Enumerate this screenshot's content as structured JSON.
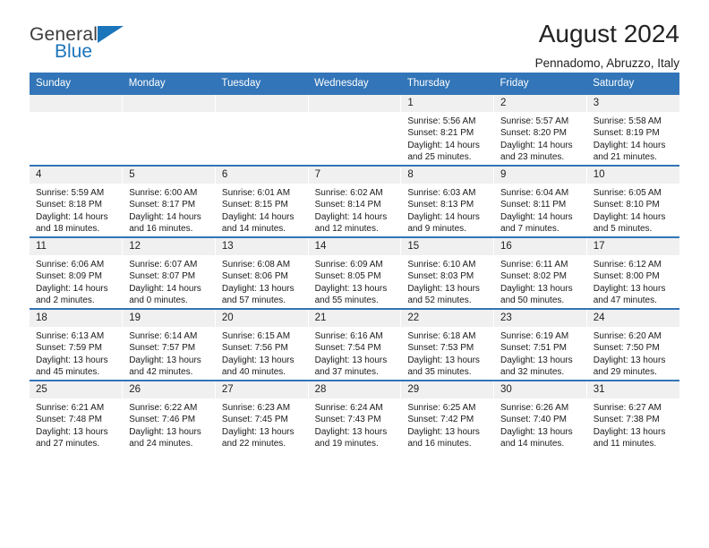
{
  "brand": {
    "name_part1": "General",
    "name_part2": "Blue",
    "triangle_color": "#1b75bb"
  },
  "header": {
    "title": "August 2024",
    "subtitle": "Pennadomo, Abruzzo, Italy"
  },
  "theme": {
    "header_row_bg": "#3275b8",
    "header_row_text": "#ffffff",
    "daynum_bg": "#f0f0f0",
    "cell_bg": "#ffffff",
    "grid_line": "#3275b8"
  },
  "weekday_headers": [
    "Sunday",
    "Monday",
    "Tuesday",
    "Wednesday",
    "Thursday",
    "Friday",
    "Saturday"
  ],
  "labels": {
    "sunrise_prefix": "Sunrise:",
    "sunset_prefix": "Sunset:",
    "daylight_prefix": "Daylight:"
  },
  "weeks": [
    [
      {
        "day": "",
        "blank": true,
        "sunrise": "",
        "sunset": "",
        "daylight_line1": "",
        "daylight_line2": ""
      },
      {
        "day": "",
        "blank": true,
        "sunrise": "",
        "sunset": "",
        "daylight_line1": "",
        "daylight_line2": ""
      },
      {
        "day": "",
        "blank": true,
        "sunrise": "",
        "sunset": "",
        "daylight_line1": "",
        "daylight_line2": ""
      },
      {
        "day": "",
        "blank": true,
        "sunrise": "",
        "sunset": "",
        "daylight_line1": "",
        "daylight_line2": ""
      },
      {
        "day": "1",
        "blank": false,
        "sunrise": "Sunrise: 5:56 AM",
        "sunset": "Sunset: 8:21 PM",
        "daylight_line1": "Daylight: 14 hours",
        "daylight_line2": "and 25 minutes."
      },
      {
        "day": "2",
        "blank": false,
        "sunrise": "Sunrise: 5:57 AM",
        "sunset": "Sunset: 8:20 PM",
        "daylight_line1": "Daylight: 14 hours",
        "daylight_line2": "and 23 minutes."
      },
      {
        "day": "3",
        "blank": false,
        "sunrise": "Sunrise: 5:58 AM",
        "sunset": "Sunset: 8:19 PM",
        "daylight_line1": "Daylight: 14 hours",
        "daylight_line2": "and 21 minutes."
      }
    ],
    [
      {
        "day": "4",
        "blank": false,
        "sunrise": "Sunrise: 5:59 AM",
        "sunset": "Sunset: 8:18 PM",
        "daylight_line1": "Daylight: 14 hours",
        "daylight_line2": "and 18 minutes."
      },
      {
        "day": "5",
        "blank": false,
        "sunrise": "Sunrise: 6:00 AM",
        "sunset": "Sunset: 8:17 PM",
        "daylight_line1": "Daylight: 14 hours",
        "daylight_line2": "and 16 minutes."
      },
      {
        "day": "6",
        "blank": false,
        "sunrise": "Sunrise: 6:01 AM",
        "sunset": "Sunset: 8:15 PM",
        "daylight_line1": "Daylight: 14 hours",
        "daylight_line2": "and 14 minutes."
      },
      {
        "day": "7",
        "blank": false,
        "sunrise": "Sunrise: 6:02 AM",
        "sunset": "Sunset: 8:14 PM",
        "daylight_line1": "Daylight: 14 hours",
        "daylight_line2": "and 12 minutes."
      },
      {
        "day": "8",
        "blank": false,
        "sunrise": "Sunrise: 6:03 AM",
        "sunset": "Sunset: 8:13 PM",
        "daylight_line1": "Daylight: 14 hours",
        "daylight_line2": "and 9 minutes."
      },
      {
        "day": "9",
        "blank": false,
        "sunrise": "Sunrise: 6:04 AM",
        "sunset": "Sunset: 8:11 PM",
        "daylight_line1": "Daylight: 14 hours",
        "daylight_line2": "and 7 minutes."
      },
      {
        "day": "10",
        "blank": false,
        "sunrise": "Sunrise: 6:05 AM",
        "sunset": "Sunset: 8:10 PM",
        "daylight_line1": "Daylight: 14 hours",
        "daylight_line2": "and 5 minutes."
      }
    ],
    [
      {
        "day": "11",
        "blank": false,
        "sunrise": "Sunrise: 6:06 AM",
        "sunset": "Sunset: 8:09 PM",
        "daylight_line1": "Daylight: 14 hours",
        "daylight_line2": "and 2 minutes."
      },
      {
        "day": "12",
        "blank": false,
        "sunrise": "Sunrise: 6:07 AM",
        "sunset": "Sunset: 8:07 PM",
        "daylight_line1": "Daylight: 14 hours",
        "daylight_line2": "and 0 minutes."
      },
      {
        "day": "13",
        "blank": false,
        "sunrise": "Sunrise: 6:08 AM",
        "sunset": "Sunset: 8:06 PM",
        "daylight_line1": "Daylight: 13 hours",
        "daylight_line2": "and 57 minutes."
      },
      {
        "day": "14",
        "blank": false,
        "sunrise": "Sunrise: 6:09 AM",
        "sunset": "Sunset: 8:05 PM",
        "daylight_line1": "Daylight: 13 hours",
        "daylight_line2": "and 55 minutes."
      },
      {
        "day": "15",
        "blank": false,
        "sunrise": "Sunrise: 6:10 AM",
        "sunset": "Sunset: 8:03 PM",
        "daylight_line1": "Daylight: 13 hours",
        "daylight_line2": "and 52 minutes."
      },
      {
        "day": "16",
        "blank": false,
        "sunrise": "Sunrise: 6:11 AM",
        "sunset": "Sunset: 8:02 PM",
        "daylight_line1": "Daylight: 13 hours",
        "daylight_line2": "and 50 minutes."
      },
      {
        "day": "17",
        "blank": false,
        "sunrise": "Sunrise: 6:12 AM",
        "sunset": "Sunset: 8:00 PM",
        "daylight_line1": "Daylight: 13 hours",
        "daylight_line2": "and 47 minutes."
      }
    ],
    [
      {
        "day": "18",
        "blank": false,
        "sunrise": "Sunrise: 6:13 AM",
        "sunset": "Sunset: 7:59 PM",
        "daylight_line1": "Daylight: 13 hours",
        "daylight_line2": "and 45 minutes."
      },
      {
        "day": "19",
        "blank": false,
        "sunrise": "Sunrise: 6:14 AM",
        "sunset": "Sunset: 7:57 PM",
        "daylight_line1": "Daylight: 13 hours",
        "daylight_line2": "and 42 minutes."
      },
      {
        "day": "20",
        "blank": false,
        "sunrise": "Sunrise: 6:15 AM",
        "sunset": "Sunset: 7:56 PM",
        "daylight_line1": "Daylight: 13 hours",
        "daylight_line2": "and 40 minutes."
      },
      {
        "day": "21",
        "blank": false,
        "sunrise": "Sunrise: 6:16 AM",
        "sunset": "Sunset: 7:54 PM",
        "daylight_line1": "Daylight: 13 hours",
        "daylight_line2": "and 37 minutes."
      },
      {
        "day": "22",
        "blank": false,
        "sunrise": "Sunrise: 6:18 AM",
        "sunset": "Sunset: 7:53 PM",
        "daylight_line1": "Daylight: 13 hours",
        "daylight_line2": "and 35 minutes."
      },
      {
        "day": "23",
        "blank": false,
        "sunrise": "Sunrise: 6:19 AM",
        "sunset": "Sunset: 7:51 PM",
        "daylight_line1": "Daylight: 13 hours",
        "daylight_line2": "and 32 minutes."
      },
      {
        "day": "24",
        "blank": false,
        "sunrise": "Sunrise: 6:20 AM",
        "sunset": "Sunset: 7:50 PM",
        "daylight_line1": "Daylight: 13 hours",
        "daylight_line2": "and 29 minutes."
      }
    ],
    [
      {
        "day": "25",
        "blank": false,
        "sunrise": "Sunrise: 6:21 AM",
        "sunset": "Sunset: 7:48 PM",
        "daylight_line1": "Daylight: 13 hours",
        "daylight_line2": "and 27 minutes."
      },
      {
        "day": "26",
        "blank": false,
        "sunrise": "Sunrise: 6:22 AM",
        "sunset": "Sunset: 7:46 PM",
        "daylight_line1": "Daylight: 13 hours",
        "daylight_line2": "and 24 minutes."
      },
      {
        "day": "27",
        "blank": false,
        "sunrise": "Sunrise: 6:23 AM",
        "sunset": "Sunset: 7:45 PM",
        "daylight_line1": "Daylight: 13 hours",
        "daylight_line2": "and 22 minutes."
      },
      {
        "day": "28",
        "blank": false,
        "sunrise": "Sunrise: 6:24 AM",
        "sunset": "Sunset: 7:43 PM",
        "daylight_line1": "Daylight: 13 hours",
        "daylight_line2": "and 19 minutes."
      },
      {
        "day": "29",
        "blank": false,
        "sunrise": "Sunrise: 6:25 AM",
        "sunset": "Sunset: 7:42 PM",
        "daylight_line1": "Daylight: 13 hours",
        "daylight_line2": "and 16 minutes."
      },
      {
        "day": "30",
        "blank": false,
        "sunrise": "Sunrise: 6:26 AM",
        "sunset": "Sunset: 7:40 PM",
        "daylight_line1": "Daylight: 13 hours",
        "daylight_line2": "and 14 minutes."
      },
      {
        "day": "31",
        "blank": false,
        "sunrise": "Sunrise: 6:27 AM",
        "sunset": "Sunset: 7:38 PM",
        "daylight_line1": "Daylight: 13 hours",
        "daylight_line2": "and 11 minutes."
      }
    ]
  ]
}
